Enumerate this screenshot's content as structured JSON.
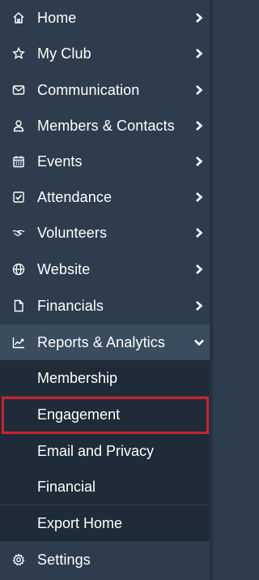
{
  "nav": {
    "items": [
      {
        "label": "Home",
        "icon": "home-icon"
      },
      {
        "label": "My Club",
        "icon": "star-icon"
      },
      {
        "label": "Communication",
        "icon": "envelope-icon"
      },
      {
        "label": "Members & Contacts",
        "icon": "person-icon"
      },
      {
        "label": "Events",
        "icon": "calendar-icon"
      },
      {
        "label": "Attendance",
        "icon": "checkbox-icon"
      },
      {
        "label": "Volunteers",
        "icon": "handshake-icon"
      },
      {
        "label": "Website",
        "icon": "globe-icon"
      },
      {
        "label": "Financials",
        "icon": "document-icon"
      },
      {
        "label": "Reports & Analytics",
        "icon": "chart-icon",
        "expanded": true
      },
      {
        "label": "Settings",
        "icon": "gear-icon"
      }
    ],
    "subitems": [
      {
        "label": "Membership"
      },
      {
        "label": "Engagement",
        "highlighted": true
      },
      {
        "label": "Email and Privacy"
      },
      {
        "label": "Financial"
      },
      {
        "label": "Export Home"
      }
    ]
  },
  "colors": {
    "background": "#2d3d4e",
    "expanded_background": "#3a4c5e",
    "submenu_background": "#1f2b38",
    "highlight_border": "#d0212f",
    "text": "#ffffff"
  }
}
